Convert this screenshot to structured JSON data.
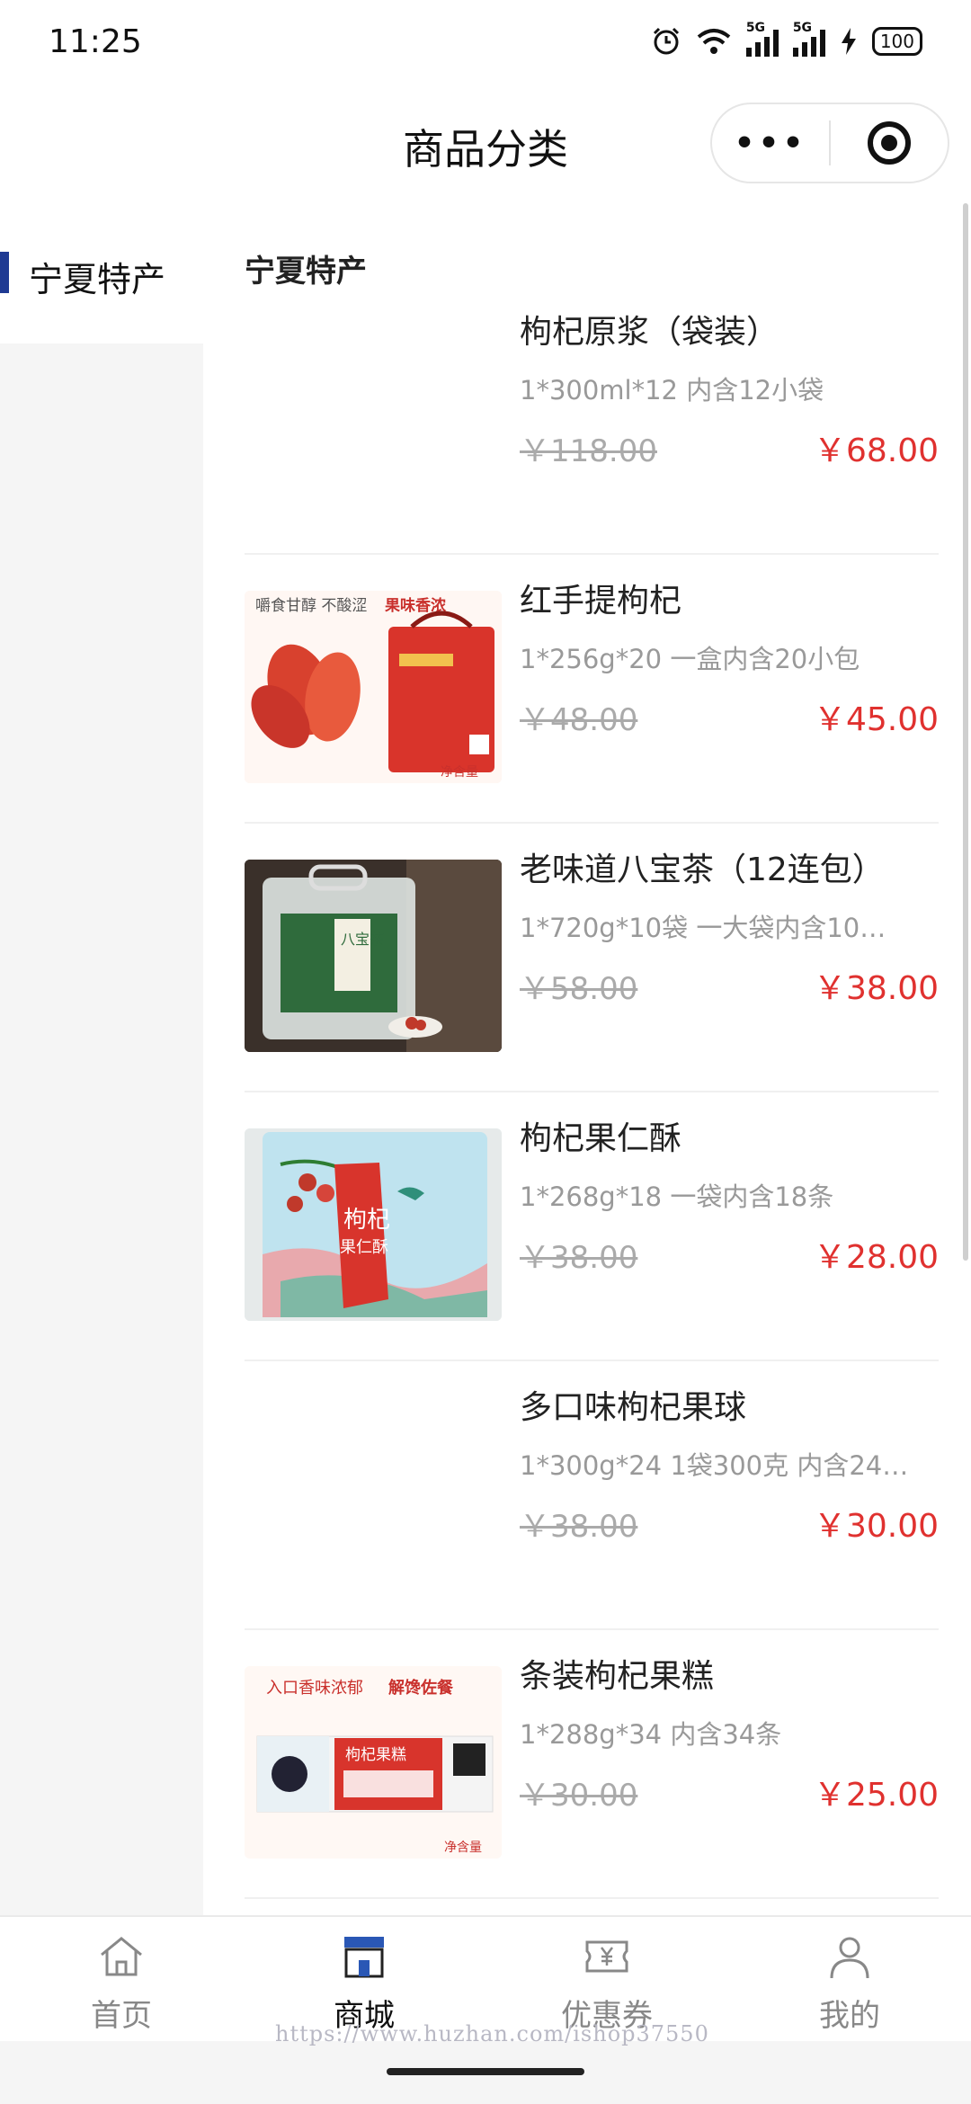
{
  "status_bar": {
    "time": "11:25",
    "network_label": "5G",
    "battery": "100"
  },
  "nav": {
    "title": "商品分类",
    "more_icon": "more-dots-icon",
    "target_icon": "target-icon"
  },
  "sidebar": {
    "items": [
      {
        "label": "宁夏特产",
        "active": true
      }
    ]
  },
  "section": {
    "title": "宁夏特产"
  },
  "products": [
    {
      "name": "枸杞原浆（袋装）",
      "spec": "1*300ml*12 内含12小袋",
      "old_price": "￥118.00",
      "price": "￥68.00"
    },
    {
      "name": "红手提枸杞",
      "spec": "1*256g*20 一盒内含20小包",
      "old_price": "￥48.00",
      "price": "￥45.00",
      "image_text": {
        "a": "嚼食甘醇 不酸涩",
        "b": "果味香浓",
        "c": "净含量"
      }
    },
    {
      "name": "老味道八宝茶（12连包）",
      "spec": "1*720g*10袋 一大袋内含10…",
      "old_price": "￥58.00",
      "price": "￥38.00",
      "image_text": {
        "a": "八宝茶"
      }
    },
    {
      "name": "枸杞果仁酥",
      "spec": "1*268g*18 一袋内含18条",
      "old_price": "￥38.00",
      "price": "￥28.00",
      "image_text": {
        "a": "枸杞",
        "b": "果仁酥"
      }
    },
    {
      "name": "多口味枸杞果球",
      "spec": "1*300g*24 1袋300克 内含24…",
      "old_price": "￥38.00",
      "price": "￥30.00"
    },
    {
      "name": "条装枸杞果糕",
      "spec": "1*288g*34 内含34条",
      "old_price": "￥30.00",
      "price": "￥25.00",
      "image_text": {
        "a": "入口香味浓郁",
        "b": "解馋佐餐",
        "c": "枸杞果糕",
        "d": "净含量"
      }
    }
  ],
  "tabbar": {
    "tabs": [
      {
        "label": "首页",
        "icon": "home-icon"
      },
      {
        "label": "商城",
        "icon": "store-icon",
        "active": true
      },
      {
        "label": "优惠券",
        "icon": "coupon-icon"
      },
      {
        "label": "我的",
        "icon": "user-icon"
      }
    ]
  },
  "watermark": "https://www.huzhan.com/ishop37550",
  "colors": {
    "price_red": "#e0312f",
    "accent_blue": "#1f3a93",
    "sidebar_bg": "#f5f5f5"
  }
}
